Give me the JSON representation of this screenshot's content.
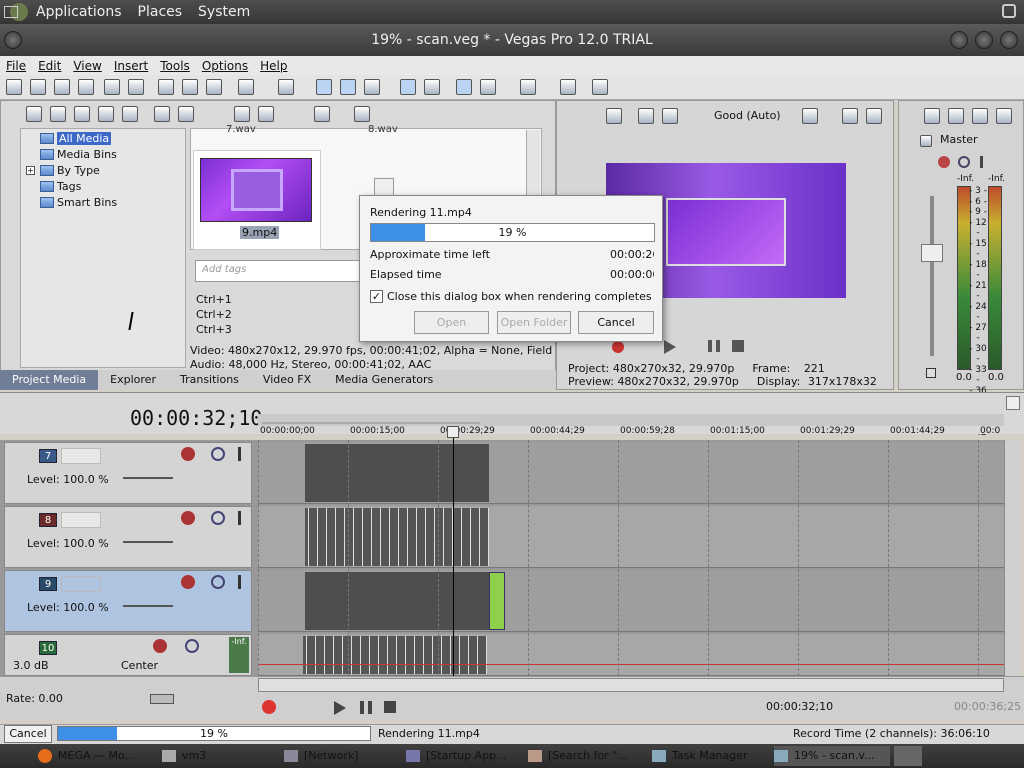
{
  "gnome_panel": {
    "applications": "Applications",
    "places": "Places",
    "system": "System"
  },
  "window": {
    "title": "19% - scan.veg * - Vegas Pro 12.0 TRIAL"
  },
  "menu": [
    "File",
    "Edit",
    "View",
    "Insert",
    "Tools",
    "Options",
    "Help"
  ],
  "explorer": {
    "tree": [
      "All Media",
      "Media Bins",
      "By Type",
      "Tags",
      "Smart Bins"
    ],
    "files_top": [
      "7.wav",
      "8.wav"
    ],
    "thumb_label": "9.mp4",
    "tags_placeholder": "Add tags",
    "shortcuts": [
      "Ctrl+1",
      "Ctrl+2",
      "Ctrl+3"
    ],
    "info_video": "Video: 480x270x12, 29.970 fps, 00:00:41;02, Alpha = None, Field Order",
    "info_audio": "Audio: 48,000 Hz, Stereo, 00:00:41;02, AAC",
    "tabs": [
      "Project Media",
      "Explorer",
      "Transitions",
      "Video FX",
      "Media Generators"
    ]
  },
  "preview": {
    "quality": "Good (Auto)",
    "project_label": "Project:",
    "project_value": "480x270x32, 29.970p",
    "frame_label": "Frame:",
    "frame_value": "221",
    "preview_label": "Preview:",
    "preview_value": "480x270x32, 29.970p",
    "display_label": "Display:",
    "display_value": "317x178x32"
  },
  "master": {
    "title": "Master",
    "inf_l": "-Inf.",
    "inf_r": "-Inf.",
    "scale": [
      "3",
      "6",
      "9",
      "12",
      "15",
      "18",
      "21",
      "24",
      "27",
      "30",
      "33",
      "36",
      "39",
      "42",
      "45",
      "48",
      "51",
      "54",
      "57"
    ],
    "val_l": "0.0",
    "val_r": "0.0"
  },
  "timeline": {
    "timecode": "00:00:32;10",
    "ruler": [
      "00:00:00;00",
      "00:00:15;00",
      "00:00:29;29",
      "00:00:44;29",
      "00:00:59;28",
      "00:01:15;00",
      "00:01:29;29",
      "00:01:44;29",
      "00:0"
    ],
    "tracks": [
      {
        "num": "7",
        "level": "Level: 100.0 %"
      },
      {
        "num": "8",
        "level": "Level: 100.0 %"
      },
      {
        "num": "9",
        "level": "Level: 100.0 %"
      },
      {
        "num": "10",
        "vol": "3.0 dB",
        "pan": "Center",
        "inf": "-Inf."
      }
    ]
  },
  "transport": {
    "rate": "Rate: 0.00",
    "time": "00:00:32;10",
    "end": "00:00:36;25"
  },
  "statusbar": {
    "cancel": "Cancel",
    "progress": "19 %",
    "progress_value": 0.19,
    "rendering": "Rendering 11.mp4",
    "record_time": "Record Time (2 channels): 36:06:10"
  },
  "dialog": {
    "title": "Rendering 11.mp4",
    "progress": "19 %",
    "progress_value": 0.19,
    "approx_label": "Approximate time left",
    "approx_value": "00:00:26",
    "elapsed_label": "Elapsed time",
    "elapsed_value": "00:00:06",
    "checkbox_label": "Close this dialog box when rendering completes",
    "checkbox_checked": true,
    "open": "Open",
    "open_folder": "Open Folder",
    "cancel": "Cancel"
  },
  "taskbar": [
    "MEGA — Mo...",
    "vm3",
    "[Network]",
    "[Startup App...",
    "[Search for \"...",
    "Task Manager",
    "19% - scan.v..."
  ],
  "colors": {
    "accent": "#3d8fe8",
    "selection": "#3c68c8",
    "video_purple": "#8a3fe0"
  }
}
